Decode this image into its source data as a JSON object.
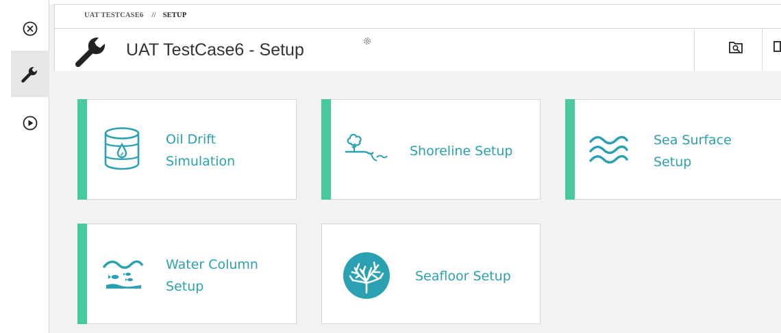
{
  "sidebar": {
    "close_icon": "close-circle-icon",
    "setup_icon": "wrench-icon",
    "run_icon": "play-circle-icon"
  },
  "breadcrumb": {
    "items": [
      "UAT TESTCASE6",
      "SETUP"
    ],
    "separator": "//"
  },
  "header": {
    "title": "UAT TestCase6 - Setup",
    "title_icon": "wrench-icon",
    "settings_icon": "gear-icon",
    "actions": [
      "search-folder-icon",
      "copy-icon"
    ]
  },
  "cards": [
    {
      "label": "Oil Drift\nSimulation",
      "icon": "oil-barrel-icon",
      "accent": true
    },
    {
      "label": "Shoreline Setup",
      "icon": "shoreline-icon",
      "accent": true
    },
    {
      "label": "Sea Surface\nSetup",
      "icon": "waves-icon",
      "accent": true
    },
    {
      "label": "Water Column\nSetup",
      "icon": "water-column-fish-icon",
      "accent": true
    },
    {
      "label": "Seafloor Setup",
      "icon": "coral-icon",
      "accent": false
    }
  ],
  "colors": {
    "accent": "#47c9a0",
    "card_text": "#2aa0b3",
    "icon_teal": "#2aa0b3",
    "background": "#f2f2f2"
  }
}
